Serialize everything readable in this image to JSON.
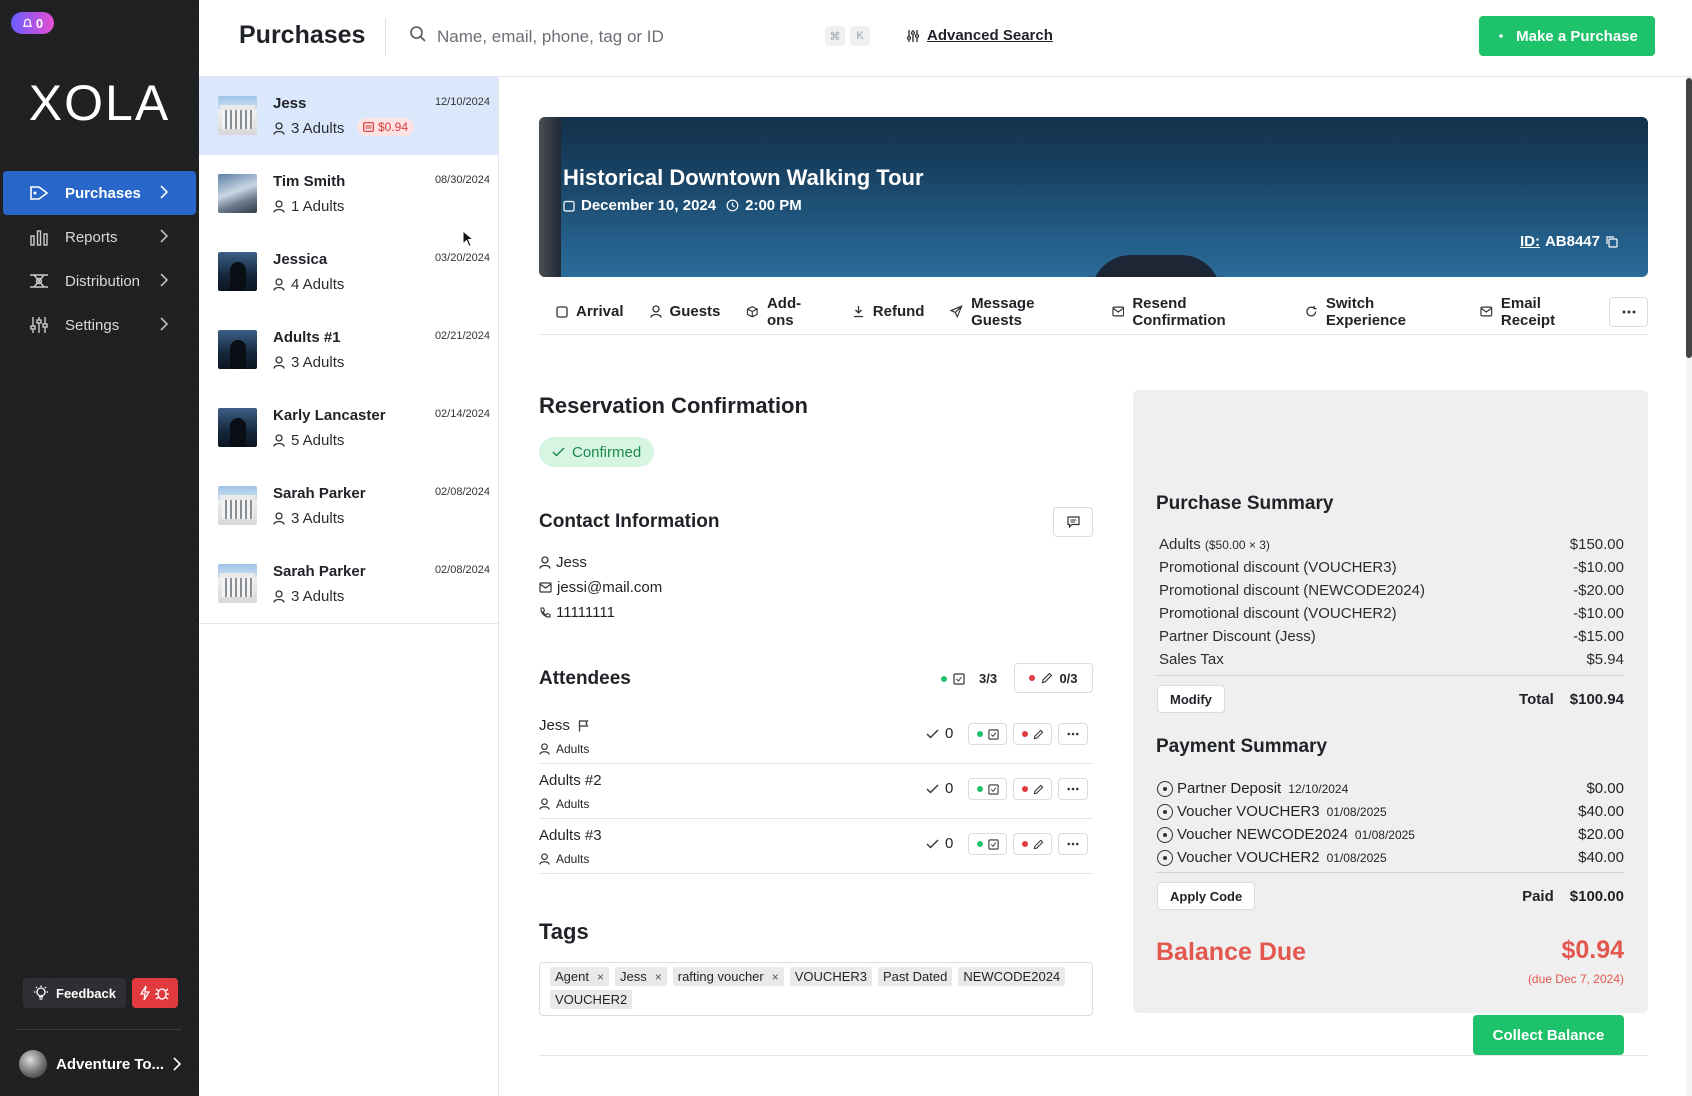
{
  "sidebar": {
    "notification_count": "0",
    "logo": "XOLA",
    "items": [
      {
        "label": "Purchases",
        "icon": "tag-icon",
        "active": true
      },
      {
        "label": "Reports",
        "icon": "bar-chart-icon"
      },
      {
        "label": "Distribution",
        "icon": "distribution-icon"
      },
      {
        "label": "Settings",
        "icon": "sliders-icon"
      }
    ],
    "feedback_label": "Feedback",
    "account_name": "Adventure To..."
  },
  "header": {
    "title": "Purchases",
    "search_placeholder": "Name, email, phone, tag or ID",
    "shortcut_keys": [
      "⌘",
      "K"
    ],
    "advanced_search": "Advanced Search",
    "make_purchase": "Make a Purchase"
  },
  "purchases": [
    {
      "name": "Jess",
      "date": "12/10/2024",
      "guests": "3 Adults",
      "due": "$0.94",
      "thumb": "building",
      "active": true
    },
    {
      "name": "Tim Smith",
      "date": "08/30/2024",
      "guests": "1 Adults",
      "thumb": "city"
    },
    {
      "name": "Jessica",
      "date": "03/20/2024",
      "guests": "4 Adults",
      "thumb": "dark"
    },
    {
      "name": "Adults #1",
      "date": "02/21/2024",
      "guests": "3 Adults",
      "thumb": "dark"
    },
    {
      "name": "Karly Lancaster",
      "date": "02/14/2024",
      "guests": "5 Adults",
      "thumb": "dark"
    },
    {
      "name": "Sarah Parker",
      "date": "02/08/2024",
      "guests": "3 Adults",
      "thumb": "building"
    },
    {
      "name": "Sarah Parker",
      "date": "02/08/2024",
      "guests": "3 Adults",
      "thumb": "building"
    }
  ],
  "experience": {
    "title": "Historical Downtown Walking Tour",
    "date": "December 10, 2024",
    "time": "2:00 PM",
    "id_label": "ID:",
    "id_value": "AB8447"
  },
  "actions": [
    "Arrival",
    "Guests",
    "Add-ons",
    "Refund",
    "Message Guests",
    "Resend Confirmation",
    "Switch Experience",
    "Email Receipt"
  ],
  "reservation": {
    "heading": "Reservation Confirmation",
    "status": "Confirmed"
  },
  "contact": {
    "heading": "Contact Information",
    "name": "Jess",
    "email": "jessi@mail.com",
    "phone": "11111111"
  },
  "attendees": {
    "heading": "Attendees",
    "checked_in": "3/3",
    "signed": "0/3",
    "list": [
      {
        "name": "Jess",
        "type": "Adults",
        "count": "0",
        "flag": true
      },
      {
        "name": "Adults #2",
        "type": "Adults",
        "count": "0"
      },
      {
        "name": "Adults #3",
        "type": "Adults",
        "count": "0"
      }
    ]
  },
  "tags": {
    "heading": "Tags",
    "items": [
      {
        "label": "Agent",
        "removable": true
      },
      {
        "label": "Jess",
        "removable": true
      },
      {
        "label": "rafting voucher",
        "removable": true
      },
      {
        "label": "VOUCHER3"
      },
      {
        "label": "Past Dated"
      },
      {
        "label": "NEWCODE2024"
      },
      {
        "label": "VOUCHER2"
      }
    ]
  },
  "purchase_summary": {
    "heading": "Purchase Summary",
    "lines": [
      {
        "label": "Adults",
        "sub": "($50.00 × 3)",
        "amount": "$150.00"
      },
      {
        "label": "Promotional discount (VOUCHER3)",
        "amount": "-$10.00"
      },
      {
        "label": "Promotional discount (NEWCODE2024)",
        "amount": "-$20.00"
      },
      {
        "label": "Promotional discount (VOUCHER2)",
        "amount": "-$10.00"
      },
      {
        "label": "Partner Discount (Jess)",
        "amount": "-$15.00"
      },
      {
        "label": "Sales Tax",
        "amount": "$5.94"
      }
    ],
    "modify_label": "Modify",
    "total_label": "Total",
    "total_value": "$100.94"
  },
  "payment_summary": {
    "heading": "Payment Summary",
    "lines": [
      {
        "label": "Partner Deposit",
        "date": "12/10/2024",
        "amount": "$0.00"
      },
      {
        "label": "Voucher VOUCHER3",
        "date": "01/08/2025",
        "amount": "$40.00"
      },
      {
        "label": "Voucher NEWCODE2024",
        "date": "01/08/2025",
        "amount": "$20.00"
      },
      {
        "label": "Voucher VOUCHER2",
        "date": "01/08/2025",
        "amount": "$40.00"
      }
    ],
    "apply_code_label": "Apply Code",
    "paid_label": "Paid",
    "paid_value": "$100.00"
  },
  "balance": {
    "label": "Balance Due",
    "amount": "$0.94",
    "due_note": "(due Dec 7, 2024)",
    "collect_label": "Collect Balance"
  },
  "colors": {
    "sidebar_bg": "#1e1f21",
    "active_nav": "#2867c9",
    "primary_green": "#1ec26a",
    "balance_red": "#e4574f",
    "selected_row": "#dbe8fb"
  }
}
